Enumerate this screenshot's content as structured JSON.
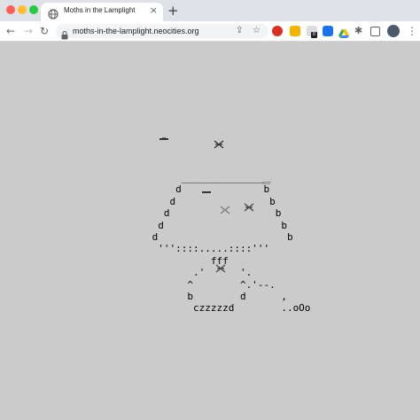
{
  "browser": {
    "tab_title": "Moths in the Lamplight",
    "url": "moths-in-the-lamplight.neocities.org",
    "tab_close_glyph": "×",
    "new_tab_glyph": "+",
    "back_glyph": "←",
    "forward_glyph": "→",
    "reload_glyph": "↻",
    "share_glyph": "⇪",
    "star_glyph": "☆",
    "extensions_glyph": "✱",
    "menu_glyph": "⋮",
    "extension_badge": "0"
  },
  "page": {
    "ascii_art_lines": [
      "      ______________",
      "     d              b",
      "    d                b",
      "   d                  b",
      "  d                    b",
      " d                      b",
      "  '''::::.....::::'''",
      "           fff",
      "        .'      '.",
      "       ^        ^.'--.",
      "       b        d      ,",
      "        czzzzzd        ..oOo"
    ]
  },
  "colors": {
    "background": "#cbcbcb",
    "tab_strip": "#dee1e6",
    "toolbar": "#ffffff"
  }
}
